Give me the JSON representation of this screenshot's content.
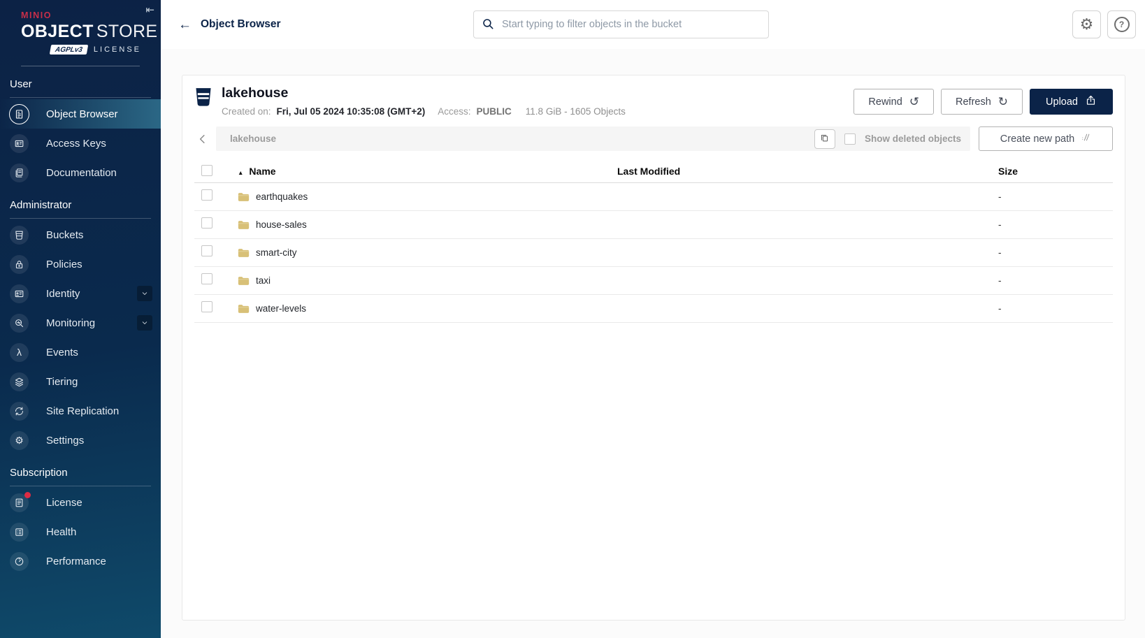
{
  "brand": {
    "name": "MINIO",
    "product_bold": "OBJECT",
    "product_light": "STORE",
    "badge": "AGPLv3",
    "license_label": "LICENSE"
  },
  "icon_glyphs": {
    "collapse-sidebar-icon": "⇤",
    "back-arrow-icon": "←",
    "rewind-icon": "↺",
    "refresh-icon": "↻",
    "settings-gear-icon": "⚙",
    "help-icon": "?",
    "sort-asc-icon": "▲",
    "events-icon": "λ",
    "settings-icon": "⚙"
  },
  "sidebar": {
    "sections": [
      {
        "label": "User",
        "items": [
          {
            "label": "Object Browser",
            "icon": "object-browser-icon",
            "active": true
          },
          {
            "label": "Access Keys",
            "icon": "access-keys-icon"
          },
          {
            "label": "Documentation",
            "icon": "documentation-icon"
          }
        ]
      },
      {
        "label": "Administrator",
        "items": [
          {
            "label": "Buckets",
            "icon": "buckets-icon"
          },
          {
            "label": "Policies",
            "icon": "policies-icon"
          },
          {
            "label": "Identity",
            "icon": "identity-icon",
            "expandable": true
          },
          {
            "label": "Monitoring",
            "icon": "monitoring-icon",
            "expandable": true
          },
          {
            "label": "Events",
            "icon": "events-icon"
          },
          {
            "label": "Tiering",
            "icon": "tiering-icon"
          },
          {
            "label": "Site Replication",
            "icon": "site-replication-icon"
          },
          {
            "label": "Settings",
            "icon": "settings-icon"
          }
        ]
      },
      {
        "label": "Subscription",
        "items": [
          {
            "label": "License",
            "icon": "license-icon",
            "badge": true
          },
          {
            "label": "Health",
            "icon": "health-icon"
          },
          {
            "label": "Performance",
            "icon": "performance-icon"
          }
        ]
      }
    ]
  },
  "header": {
    "title": "Object Browser",
    "search_placeholder": "Start typing to filter objects in the bucket"
  },
  "bucket": {
    "name": "lakehouse",
    "created_label": "Created on:",
    "created_value": "Fri, Jul 05 2024 10:35:08 (GMT+2)",
    "access_label": "Access:",
    "access_value": "PUBLIC",
    "usage": "11.8 GiB - 1605 Objects",
    "rewind_label": "Rewind",
    "refresh_label": "Refresh",
    "upload_label": "Upload"
  },
  "browser": {
    "path": "lakehouse",
    "show_deleted_label": "Show deleted objects",
    "create_path_label": "Create new path"
  },
  "table": {
    "columns": [
      "Name",
      "Last Modified",
      "Size"
    ],
    "sort": {
      "column": "Name",
      "direction": "asc"
    },
    "rows": [
      {
        "name": "earthquakes",
        "icon": "folder-icon",
        "last_modified": "",
        "size": "-"
      },
      {
        "name": "house-sales",
        "icon": "folder-icon",
        "last_modified": "",
        "size": "-"
      },
      {
        "name": "smart-city",
        "icon": "folder-icon",
        "last_modified": "",
        "size": "-"
      },
      {
        "name": "taxi",
        "icon": "folder-icon",
        "last_modified": "",
        "size": "-"
      },
      {
        "name": "water-levels",
        "icon": "folder-icon",
        "last_modified": "",
        "size": "-"
      }
    ]
  },
  "colors": {
    "accent_navy": "#0B2348",
    "logo_red": "#C72E49",
    "folder_tan": "#D8C077",
    "selected_item_teal": "#2D6B89",
    "alert_red": "#DC2B43"
  }
}
